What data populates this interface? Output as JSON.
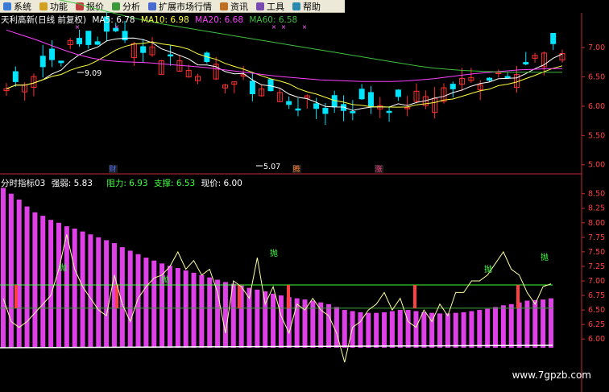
{
  "menubar": {
    "items": [
      {
        "label": "系统",
        "icon": "system-icon"
      },
      {
        "label": "功能",
        "icon": "function-icon"
      },
      {
        "label": "报价",
        "icon": "quote-icon"
      },
      {
        "label": "分析",
        "icon": "analysis-icon"
      },
      {
        "label": "扩展市场行情",
        "icon": "market-icon"
      },
      {
        "label": "资讯",
        "icon": "news-icon"
      },
      {
        "label": "工具",
        "icon": "tools-icon"
      },
      {
        "label": "帮助",
        "icon": "help-icon"
      }
    ]
  },
  "top_panel": {
    "stock_title": "天利高新(日线 前复权)",
    "ma5_label": "MA5:",
    "ma5_value": "6.78",
    "ma10_label": "MA10:",
    "ma10_value": "6.98",
    "ma20_label": "MA20:",
    "ma20_value": "6.68",
    "ma60_label": "MA60:",
    "ma60_value": "6.58",
    "high_marker": "9.09",
    "low_marker": "5.07",
    "event_markers": [
      "财",
      "腾",
      "涨"
    ],
    "colors": {
      "up": "#ff3030",
      "down": "#00e5ff",
      "ma5": "#ffffff",
      "ma10": "#ffff40",
      "ma20": "#ff40ff",
      "ma60": "#40c040"
    }
  },
  "bottom_panel": {
    "indicator_name": "分时指标03",
    "strength_label": "强弱:",
    "strength_value": "5.83",
    "resist_label": "阻力:",
    "resist_value": "6.93",
    "support_label": "支撑:",
    "support_value": "6.53",
    "price_label": "现价:",
    "price_value": "6.00",
    "signal_text": "抛",
    "colors": {
      "bar": "#e040e8",
      "resist": "#40ff40",
      "support": "#ff4040",
      "line": "#ffffa0"
    }
  },
  "chart_data": [
    {
      "type": "line",
      "name": "candlestick-price-panel",
      "y_ticks": [
        "7.00",
        "6.50",
        "6.00",
        "5.50",
        "5.00"
      ],
      "ylim": [
        4.9,
        7.4
      ],
      "ma20": [
        7.3,
        7.22,
        7.14,
        7.05,
        6.96,
        6.88,
        6.82,
        6.78,
        6.76,
        6.75,
        6.74,
        6.72,
        6.7,
        6.68,
        6.66,
        6.63,
        6.6,
        6.57,
        6.54,
        6.51,
        6.49,
        6.47,
        6.45,
        6.44,
        6.43,
        6.42,
        6.42,
        6.42,
        6.43,
        6.45,
        6.47,
        6.5,
        6.53,
        6.56,
        6.58,
        6.6,
        6.62,
        6.63,
        6.64,
        6.64
      ],
      "ma60": [
        8.0,
        7.95,
        7.9,
        7.85,
        7.8,
        7.75,
        7.68,
        7.62,
        7.56,
        7.5,
        7.45,
        7.4,
        7.36,
        7.32,
        7.28,
        7.24,
        7.2,
        7.16,
        7.12,
        7.08,
        7.04,
        7.0,
        6.96,
        6.92,
        6.88,
        6.84,
        6.8,
        6.76,
        6.72,
        6.68,
        6.65,
        6.63,
        6.61,
        6.6,
        6.59,
        6.58,
        6.58,
        6.58,
        6.58,
        6.58
      ]
    },
    {
      "type": "bar",
      "name": "indicator-panel",
      "y_ticks": [
        "8.50",
        "8.25",
        "8.00",
        "7.75",
        "7.50",
        "7.25",
        "7.00",
        "6.75",
        "6.50",
        "6.25",
        "6.00"
      ],
      "ylim": [
        5.85,
        8.62
      ],
      "resist": 6.93,
      "support": 6.53,
      "values": [
        8.6,
        8.5,
        8.4,
        8.28,
        8.18,
        8.12,
        8.05,
        8.0,
        7.94,
        7.9,
        7.85,
        7.8,
        7.75,
        7.7,
        7.65,
        7.58,
        7.52,
        7.46,
        7.4,
        7.35,
        7.3,
        7.26,
        7.22,
        7.18,
        7.14,
        7.1,
        7.06,
        7.02,
        6.98,
        6.95,
        6.92,
        6.88,
        6.85,
        6.82,
        6.78,
        6.75,
        6.72,
        6.7,
        6.68,
        6.66,
        6.63,
        6.6,
        6.55,
        6.5,
        6.48,
        6.46,
        6.45,
        6.45,
        6.46,
        6.48,
        6.5,
        6.5,
        6.48,
        6.46,
        6.45,
        6.44,
        6.44,
        6.45,
        6.46,
        6.48,
        6.5,
        6.52,
        6.55,
        6.58,
        6.6,
        6.63,
        6.66,
        6.67,
        6.68,
        6.7
      ],
      "line": [
        6.7,
        6.3,
        6.2,
        6.3,
        6.45,
        6.6,
        6.75,
        7.2,
        7.8,
        7.2,
        6.9,
        6.7,
        6.5,
        6.4,
        7.1,
        6.6,
        6.3,
        6.7,
        6.9,
        7.05,
        7.1,
        7.25,
        7.5,
        7.2,
        7.35,
        7.1,
        7.2,
        6.8,
        6.1,
        7.0,
        6.9,
        6.7,
        7.4,
        6.6,
        6.9,
        6.4,
        6.1,
        6.6,
        6.5,
        6.7,
        6.5,
        6.4,
        6.1,
        5.6,
        6.2,
        6.3,
        6.5,
        6.6,
        6.8,
        6.5,
        6.7,
        6.3,
        6.2,
        6.5,
        6.3,
        6.6,
        6.4,
        6.8,
        6.8,
        7.0,
        7.0,
        7.1,
        7.3,
        7.5,
        7.2,
        7.1,
        6.8,
        6.6,
        6.9,
        6.95
      ]
    }
  ],
  "watermark": "www.7gpzb.com"
}
